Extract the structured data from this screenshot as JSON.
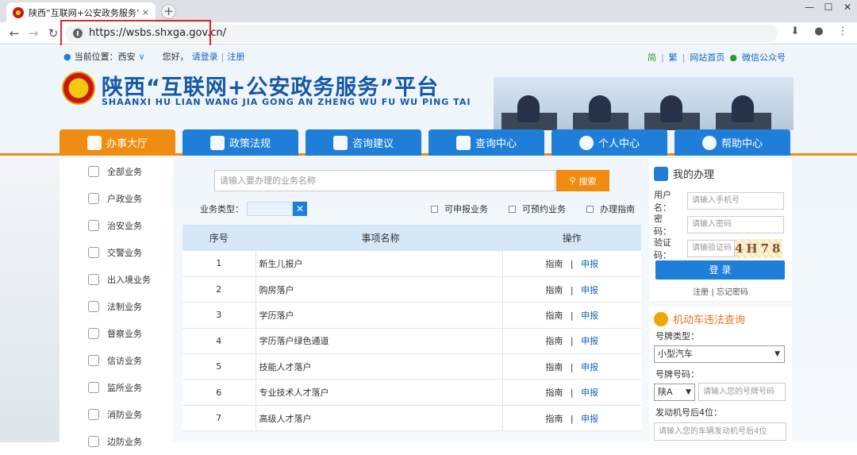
{
  "browser": {
    "tab_title": "陕西“互联网+公安政务服务”平",
    "tab_close": "×",
    "new_tab": "+",
    "url": "https://wsbs.shxga.gov.cn/",
    "window_controls": [
      "—",
      "☐",
      "✕"
    ]
  },
  "topbar": {
    "location_label": "当前位置：西安",
    "greeting": "您好，",
    "login_link": "请登录",
    "divider": "|",
    "register_link": "注册",
    "links": [
      "简",
      "繁",
      "网站首页",
      "微信公众号"
    ]
  },
  "header": {
    "title": "陕西“互联网+公安政务服务”平台",
    "subtitle": "SHAANXI HU LIAN WANG JIA GONG AN ZHENG WU FU WU PING TAI"
  },
  "nav": {
    "tabs": [
      "办事大厅",
      "政策法规",
      "咨询建议",
      "查询中心",
      "个人中心",
      "帮助中心"
    ]
  },
  "sidebar": {
    "items": [
      "全部业务",
      "户政业务",
      "治安业务",
      "交警业务",
      "出入境业务",
      "法制业务",
      "督察业务",
      "信访业务",
      "监所业务",
      "消防业务",
      "边防业务"
    ]
  },
  "search": {
    "placeholder": "请输入要办理的业务名称",
    "button": "搜索",
    "type_label": "业务类型：",
    "clear": "✕",
    "filters": [
      "可申报业务",
      "可预约业务",
      "办理指南"
    ]
  },
  "table": {
    "headers": [
      "序号",
      "事项名称",
      "操作"
    ],
    "rows": [
      {
        "no": "1",
        "name": "新生儿报户",
        "guide": "指南",
        "sep": "|",
        "apply": "申报"
      },
      {
        "no": "2",
        "name": "购房落户",
        "guide": "指南",
        "sep": "|",
        "apply": "申报"
      },
      {
        "no": "3",
        "name": "学历落户",
        "guide": "指南",
        "sep": "|",
        "apply": "申报"
      },
      {
        "no": "4",
        "name": "学历落户绿色通道",
        "guide": "指南",
        "sep": "|",
        "apply": "申报"
      },
      {
        "no": "5",
        "name": "技能人才落户",
        "guide": "指南",
        "sep": "|",
        "apply": "申报"
      },
      {
        "no": "6",
        "name": "专业技术人才落户",
        "guide": "指南",
        "sep": "|",
        "apply": "申报"
      },
      {
        "no": "7",
        "name": "高级人才落户",
        "guide": "指南",
        "sep": "|",
        "apply": "申报"
      }
    ]
  },
  "login": {
    "title": "我的办理",
    "username_label": "用户名：",
    "username_placeholder": "请输入手机号",
    "password_label": "密　码：",
    "password_placeholder": "请输入密码",
    "captcha_label": "验证码：",
    "captcha_placeholder": "请输验证码",
    "captcha_text": "4H78",
    "button": "登 录",
    "register": "注册",
    "divider": "|",
    "forgot": "忘记密码"
  },
  "violation": {
    "title": "机动车违法查询",
    "plate_type_label": "号牌类型：",
    "plate_type_value": "小型汽车",
    "plate_no_label": "号牌号码：",
    "province_value": "陕A",
    "plate_no_placeholder": "请输入您的号牌号码",
    "engine_label": "发动机号后4位：",
    "engine_placeholder": "请输入您的车辆发动机号后4位"
  },
  "colors": {
    "primary": "#1f7fd8",
    "accent": "#f08c12",
    "title": "#1557a8",
    "highlight": "#e8231f"
  }
}
